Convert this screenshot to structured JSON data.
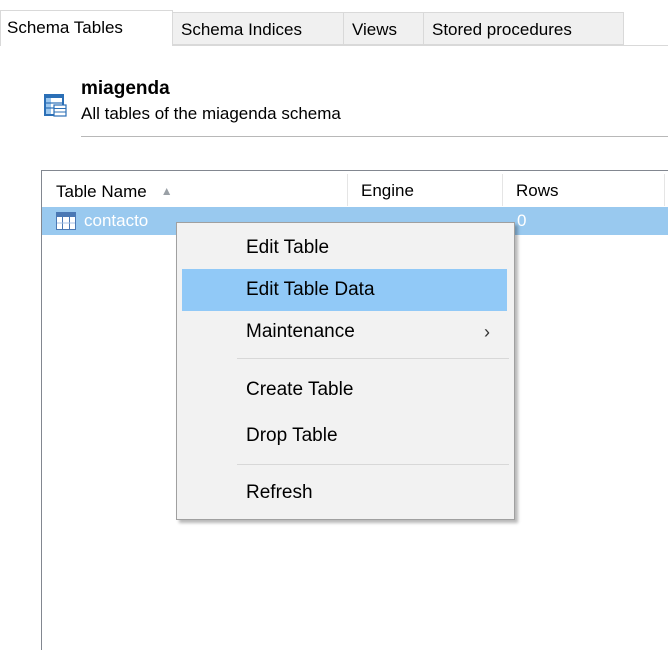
{
  "tabs": [
    {
      "label": "Schema Tables",
      "active": true
    },
    {
      "label": "Schema Indices",
      "active": false
    },
    {
      "label": "Views",
      "active": false
    },
    {
      "label": "Stored procedures",
      "active": false
    }
  ],
  "schema": {
    "name": "miagenda",
    "description": "All tables of the miagenda schema",
    "icon": "schema-tables-icon"
  },
  "table": {
    "columns": [
      "Table Name",
      "Engine",
      "Rows"
    ],
    "sort": {
      "column": "Table Name",
      "direction": "ascending"
    },
    "rows": [
      {
        "name": "contacto",
        "engine": "",
        "rows": "0",
        "selected": true,
        "icon": "table-icon"
      }
    ]
  },
  "context_menu": {
    "items": [
      {
        "label": "Edit Table"
      },
      {
        "label": "Edit Table Data",
        "highlighted": true
      },
      {
        "label": "Maintenance",
        "submenu": true
      },
      {
        "separator": true
      },
      {
        "label": "Create Table"
      },
      {
        "label": "Drop Table"
      },
      {
        "separator": true
      },
      {
        "label": "Refresh"
      }
    ]
  },
  "colors": {
    "selection": "#99c9ef",
    "menu_highlight": "#91c9f7",
    "menu_background": "#f2f2f2"
  }
}
